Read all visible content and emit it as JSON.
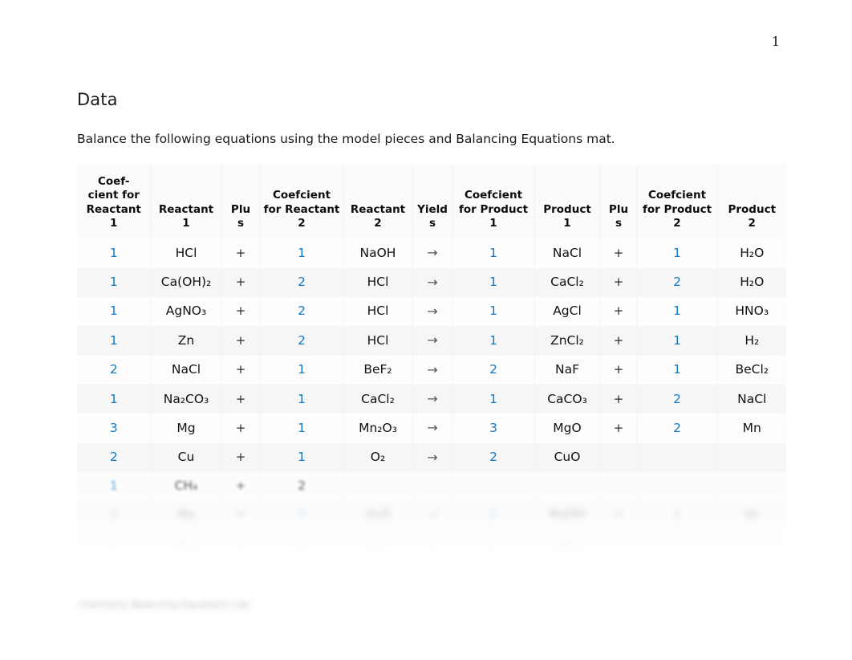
{
  "page": {
    "page_number": "1"
  },
  "document": {
    "section_heading": "Data",
    "intro_text": "Balance the following equations using the model pieces and Balancing Equations mat.",
    "footer_note": "Chemistry Balancing Equations Lab"
  },
  "table": {
    "headers": [
      "Coef-cient for Reactant 1",
      "Reactant 1",
      "Plu s",
      "Coefcient for Reactant 2",
      "Reactant 2",
      "Yield s",
      "Coefcient for Product 1",
      "Product 1",
      "Plu s",
      "Coefcient for Product 2",
      "Product 2"
    ],
    "header_lines": {
      "h0": [
        "Coef-",
        "cient for",
        "Reactant",
        "1"
      ],
      "h1": [
        "Reactant",
        "1"
      ],
      "h2": [
        "Plu",
        "s"
      ],
      "h3": [
        "Coefcient",
        "for Reactant",
        "2"
      ],
      "h4": [
        "Reactant",
        "2"
      ],
      "h5": [
        "Yield",
        "s"
      ],
      "h6": [
        "Coefcient",
        "for Product",
        "1"
      ],
      "h7": [
        "Product",
        "1"
      ],
      "h8": [
        "Plu",
        "s"
      ],
      "h9": [
        "Coefcient",
        "for Product",
        "2"
      ],
      "h10": [
        "Product",
        "2"
      ]
    },
    "plus_symbol": "+",
    "yields_symbol": "→",
    "rows": [
      {
        "coef_r1": "1",
        "reactant_1": "HCl",
        "plus_1": "+",
        "coef_r2": "1",
        "reactant_2": "NaOH",
        "yields": "→",
        "coef_p1": "1",
        "product_1": "NaCl",
        "plus_2": "+",
        "coef_p2": "1",
        "product_2": "H₂O",
        "blur": ""
      },
      {
        "coef_r1": "1",
        "reactant_1": "Ca(OH)₂",
        "plus_1": "+",
        "coef_r2": "2",
        "reactant_2": "HCl",
        "yields": "→",
        "coef_p1": "1",
        "product_1": "CaCl₂",
        "plus_2": "+",
        "coef_p2": "2",
        "product_2": "H₂O",
        "blur": ""
      },
      {
        "coef_r1": "1",
        "reactant_1": "AgNO₃",
        "plus_1": "+",
        "coef_r2": "2",
        "reactant_2": "HCl",
        "yields": "→",
        "coef_p1": "1",
        "product_1": "AgCl",
        "plus_2": "+",
        "coef_p2": "1",
        "product_2": "HNO₃",
        "blur": ""
      },
      {
        "coef_r1": "1",
        "reactant_1": "Zn",
        "plus_1": "+",
        "coef_r2": "2",
        "reactant_2": "HCl",
        "yields": "→",
        "coef_p1": "1",
        "product_1": "ZnCl₂",
        "plus_2": "+",
        "coef_p2": "1",
        "product_2": "H₂",
        "blur": ""
      },
      {
        "coef_r1": "2",
        "reactant_1": "NaCl",
        "plus_1": "+",
        "coef_r2": "1",
        "reactant_2": "BeF₂",
        "yields": "→",
        "coef_p1": "2",
        "product_1": "NaF",
        "plus_2": "+",
        "coef_p2": "1",
        "product_2": "BeCl₂",
        "blur": ""
      },
      {
        "coef_r1": "1",
        "reactant_1": "Na₂CO₃",
        "plus_1": "+",
        "coef_r2": "1",
        "reactant_2": "CaCl₂",
        "yields": "→",
        "coef_p1": "1",
        "product_1": "CaCO₃",
        "plus_2": "+",
        "coef_p2": "2",
        "product_2": "NaCl",
        "blur": ""
      },
      {
        "coef_r1": "3",
        "reactant_1": "Mg",
        "plus_1": "+",
        "coef_r2": "1",
        "reactant_2": "Mn₂O₃",
        "yields": "→",
        "coef_p1": "3",
        "product_1": "MgO",
        "plus_2": "+",
        "coef_p2": "2",
        "product_2": "Mn",
        "blur": ""
      },
      {
        "coef_r1": "2",
        "reactant_1": "Cu",
        "plus_1": "+",
        "coef_r2": "1",
        "reactant_2": "O₂",
        "yields": "→",
        "coef_p1": "2",
        "product_1": "CuO",
        "plus_2": "",
        "coef_p2": "",
        "product_2": "",
        "blur": ""
      },
      {
        "coef_r1": "1",
        "reactant_1": "CH₄",
        "plus_1": "+",
        "coef_r2": "2",
        "reactant_2": "",
        "yields": "",
        "coef_p1": "",
        "product_1": "",
        "plus_2": "",
        "coef_p2": "",
        "product_2": "",
        "blur": "blur-1",
        "coef_r2_dark": true
      },
      {
        "coef_r1": "2",
        "reactant_1": "Na",
        "plus_1": "+",
        "coef_r2": "2",
        "reactant_2": "H₂O",
        "yields": "→",
        "coef_p1": "2",
        "product_1": "NaOH",
        "plus_2": "+",
        "coef_p2": "1",
        "product_2": "H₂",
        "blur": "blur-2"
      },
      {
        "coef_r1": "1",
        "reactant_1": "N₂",
        "plus_1": "+",
        "coef_r2": "3",
        "reactant_2": "H₂",
        "yields": "→",
        "coef_p1": "2",
        "product_1": "NH₃",
        "plus_2": "",
        "coef_p2": "",
        "product_2": "",
        "blur": "blur-3"
      }
    ]
  },
  "colors": {
    "coefficient_blue": "#1679bf",
    "text_black": "#111111",
    "arrow_gray": "#555555",
    "table_bg": "#fbfbfb",
    "row_stripe": "#f6f6f6"
  }
}
